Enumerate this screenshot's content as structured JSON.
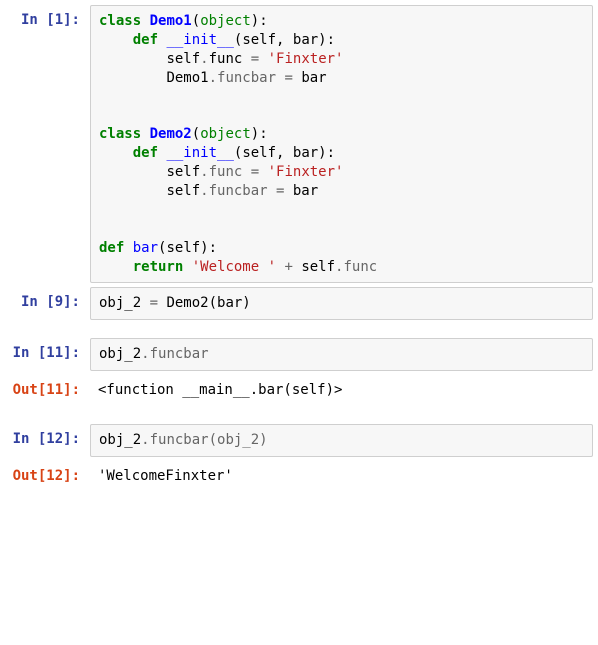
{
  "cells": {
    "c1": {
      "prompt": "In [1]:",
      "type": "in"
    },
    "c2": {
      "prompt": "In [9]:",
      "type": "in"
    },
    "c3": {
      "prompt": "In [11]:",
      "type": "in"
    },
    "c4": {
      "prompt": "Out[11]:",
      "type": "out"
    },
    "c5": {
      "prompt": "In [12]:",
      "type": "in"
    },
    "c6": {
      "prompt": "Out[12]:",
      "type": "out"
    }
  },
  "code": {
    "c1_kw_class1": "class",
    "c1_cls_demo1": "Demo1",
    "c1_p_open1": "(",
    "c1_builtin_object1": "object",
    "c1_p_close1": "):",
    "c1_kw_def1": "def",
    "c1_fn_init1": "__init__",
    "c1_params1": "(self, bar):",
    "c1_line3_a": "self",
    "c1_line3_op": ".",
    "c1_line3_b": "func ",
    "c1_line3_eq": "=",
    "c1_line3_sp": " ",
    "c1_line3_str": "'Finxter'",
    "c1_line4_a": "Demo1",
    "c1_line4_b": ".funcbar ",
    "c1_line4_eq": "=",
    "c1_line4_c": " bar",
    "c1_kw_class2": "class",
    "c1_cls_demo2": "Demo2",
    "c1_p_open2": "(",
    "c1_builtin_object2": "object",
    "c1_p_close2": "):",
    "c1_kw_def2": "def",
    "c1_fn_init2": "__init__",
    "c1_params2": "(self, bar):",
    "c1_line9_a": "self",
    "c1_line9_b": ".func ",
    "c1_line9_eq": "=",
    "c1_line9_sp": " ",
    "c1_line9_str": "'Finxter'",
    "c1_line10_a": "self",
    "c1_line10_b": ".funcbar ",
    "c1_line10_eq": "=",
    "c1_line10_c": " bar",
    "c1_kw_def3": "def",
    "c1_fn_bar": "bar",
    "c1_params3": "(self):",
    "c1_kw_return": "return",
    "c1_ret_sp": " ",
    "c1_ret_str": "'Welcome '",
    "c1_ret_plus": " + ",
    "c1_ret_self": "self",
    "c1_ret_func": ".func",
    "c2_a": "obj_2 ",
    "c2_eq": "=",
    "c2_b": " Demo2(bar)",
    "c3_a": "obj_2",
    "c3_b": ".funcbar",
    "c4_text": "<function __main__.bar(self)>",
    "c5_a": "obj_2",
    "c5_b": ".funcbar(obj_2)",
    "c6_text": "'WelcomeFinxter'"
  }
}
